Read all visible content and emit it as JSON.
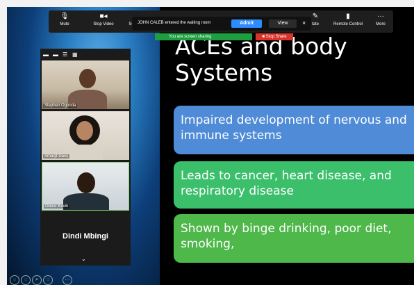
{
  "toolbar": {
    "items": [
      {
        "label": "Mute",
        "icon": "microphone-icon"
      },
      {
        "label": "Stop Video",
        "icon": "video-camera-icon"
      },
      {
        "label": "Se",
        "icon": "security-icon"
      },
      {
        "label": "tate",
        "icon": "annotate-icon"
      },
      {
        "label": "Remote Control",
        "icon": "remote-control-icon"
      },
      {
        "label": "More",
        "icon": "more-icon"
      }
    ]
  },
  "notification": {
    "text": "JOHN CALEB entered the waiting room",
    "admit_label": "Admit",
    "view_label": "View",
    "close_glyph": "×"
  },
  "share_bar": {
    "status": "You are screen sharing",
    "stop_label": "Stop Share",
    "status_color": "#1e9f3f",
    "stop_color": "#d9342b"
  },
  "gallery": {
    "participants": [
      {
        "name": "Stephen Ogonda"
      },
      {
        "name": "Amarjit Dass"
      },
      {
        "name": "Oduor Kevin"
      }
    ],
    "active_speaker": "Dindi Mbingi",
    "active_border_color": "#7fd36b"
  },
  "slide": {
    "title": "ACEs and body Systems",
    "bullets": [
      {
        "text": "Impaired development  of nervous and immune systems",
        "color": "#4f8bd6"
      },
      {
        "text": "Leads to cancer, heart disease, and respiratory disease",
        "color": "#3bbf6b"
      },
      {
        "text": "Shown by binge drinking, poor diet, smoking,",
        "color": "#4fb84a"
      }
    ]
  },
  "colors": {
    "admit_button": "#2d8cff",
    "toolbar_bg": "#1e1e1e"
  }
}
